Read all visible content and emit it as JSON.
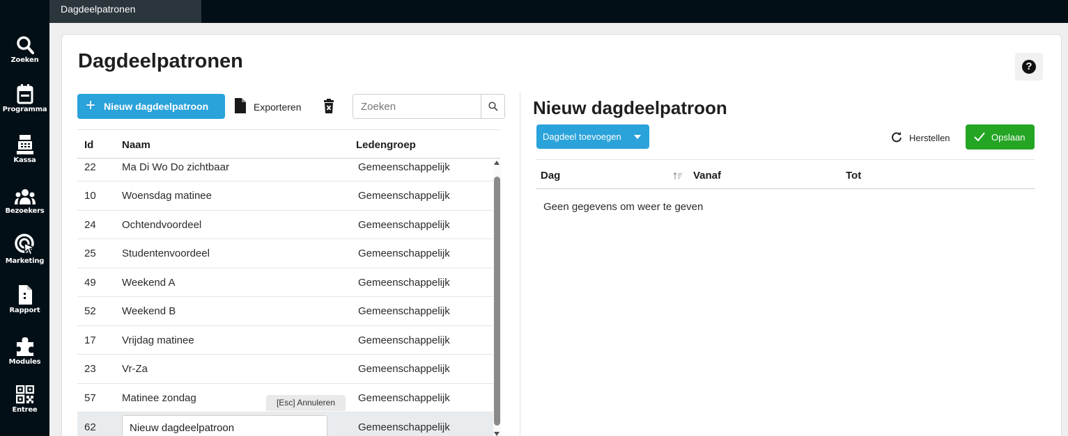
{
  "topbar": {
    "tab_label": "Dagdeelpatronen"
  },
  "sidebar": {
    "items": [
      {
        "label": "Zoeken",
        "icon": "search-icon"
      },
      {
        "label": "Programma",
        "icon": "calendar-icon"
      },
      {
        "label": "Kassa",
        "icon": "cash-register-icon"
      },
      {
        "label": "Bezoekers",
        "icon": "users-icon"
      },
      {
        "label": "Marketing",
        "icon": "target-cursor-icon"
      },
      {
        "label": "Rapport",
        "icon": "report-icon"
      },
      {
        "label": "Modules",
        "icon": "puzzle-icon"
      },
      {
        "label": "Entree",
        "icon": "qr-code-icon"
      }
    ]
  },
  "page": {
    "title": "Dagdeelpatronen",
    "help_label": "?"
  },
  "toolbar": {
    "new_label": "Nieuw dagdeelpatroon",
    "new_symbol": "+",
    "export_label": "Exporteren",
    "search_placeholder": "Zoeken"
  },
  "table": {
    "columns": {
      "id": "Id",
      "naam": "Naam",
      "ledengroep": "Ledengroep"
    },
    "rows": [
      {
        "id": "22",
        "naam": "Ma Di Wo Do zichtbaar",
        "ledengroep": "Gemeenschappelijk"
      },
      {
        "id": "10",
        "naam": "Woensdag matinee",
        "ledengroep": "Gemeenschappelijk"
      },
      {
        "id": "24",
        "naam": "Ochtendvoordeel",
        "ledengroep": "Gemeenschappelijk"
      },
      {
        "id": "25",
        "naam": "Studentenvoordeel",
        "ledengroep": "Gemeenschappelijk"
      },
      {
        "id": "49",
        "naam": "Weekend A",
        "ledengroep": "Gemeenschappelijk"
      },
      {
        "id": "52",
        "naam": "Weekend B",
        "ledengroep": "Gemeenschappelijk"
      },
      {
        "id": "17",
        "naam": "Vrijdag matinee",
        "ledengroep": "Gemeenschappelijk"
      },
      {
        "id": "23",
        "naam": "Vr-Za",
        "ledengroep": "Gemeenschappelijk"
      },
      {
        "id": "57",
        "naam": "Matinee zondag",
        "ledengroep": "Gemeenschappelijk"
      }
    ],
    "editing_row": {
      "id": "62",
      "naam": "Nieuw dagdeelpatroon",
      "ledengroep": "Gemeenschappelijk"
    },
    "esc_hint": "[Esc] Annuleren"
  },
  "detail": {
    "title": "Nieuw dagdeelpatroon",
    "add_label": "Dagdeel toevoegen",
    "reset_label": "Herstellen",
    "save_label": "Opslaan",
    "columns": {
      "dag": "Dag",
      "vanaf": "Vanaf",
      "tot": "Tot"
    },
    "empty_message": "Geen gegevens om weer te geven"
  },
  "colors": {
    "primary": "#2aa2da",
    "success": "#24a524",
    "nav_bg": "#030f16"
  }
}
